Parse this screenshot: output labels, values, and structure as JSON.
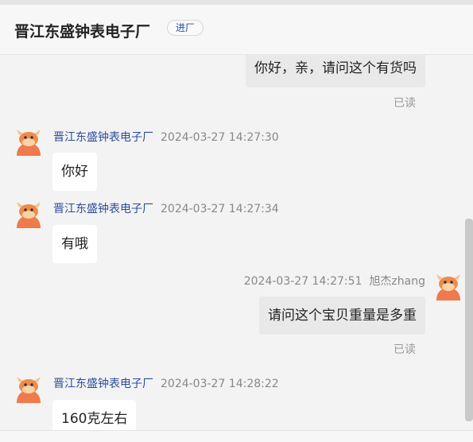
{
  "header": {
    "shop_name": "晋江东盛钟表电子厂",
    "tag": "进厂"
  },
  "messages": [
    {
      "text": "你好，亲，请问这个有货吗",
      "read": "已读"
    },
    {
      "sender": "晋江东盛钟表电子厂",
      "time": "2024-03-27 14:27:30",
      "text": "你好"
    },
    {
      "sender": "晋江东盛钟表电子厂",
      "time": "2024-03-27 14:27:34",
      "text": "有哦"
    },
    {
      "sender": "旭杰zhang",
      "time": "2024-03-27 14:27:51",
      "text": "请问这个宝贝重量是多重",
      "read": "已读"
    },
    {
      "sender": "晋江东盛钟表电子厂",
      "time": "2024-03-27 14:28:22",
      "text": "160克左右"
    }
  ],
  "icons": {
    "avatar": "cartoon-cow-avatar-icon"
  },
  "colors": {
    "sender_name": "#2c4c9c",
    "tag_text": "#1e4fa8",
    "avatar": "#ee7a4d"
  }
}
